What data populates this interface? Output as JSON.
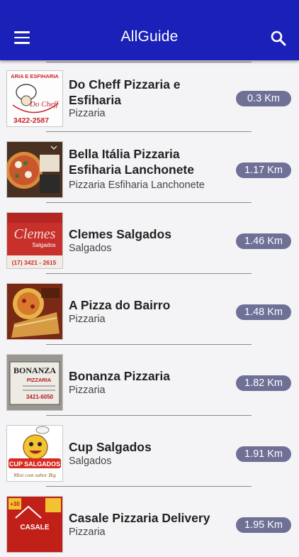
{
  "app": {
    "title": "AllGuide",
    "menu_icon": "hamburger-menu-icon",
    "search_icon": "search-icon",
    "colors": {
      "appbar": "#1a20b8",
      "badge": "#6f7096",
      "background": "#f4f4f6"
    }
  },
  "places": [
    {
      "name": "Do Cheff Pizzaria e Esfiharia",
      "category": "Pizzaria",
      "distance": "0.3 Km",
      "thumb_text": [
        "ARIA E ESFIHARIA",
        "Do Cheff",
        "3422-2587"
      ]
    },
    {
      "name": "Bella Itália Pizzaria Esfiharia Lanchonete",
      "category": "Pizzaria Esfiharia Lanchonete",
      "distance": "1.17 Km",
      "thumb_text": []
    },
    {
      "name": "Clemes Salgados",
      "category": "Salgados",
      "distance": "1.46 Km",
      "thumb_text": [
        "Clemes",
        "Salgados",
        "(17) 3421 - 2615"
      ]
    },
    {
      "name": "A Pizza do Bairro",
      "category": "Pizzaria",
      "distance": "1.48 Km",
      "thumb_text": []
    },
    {
      "name": "Bonanza Pizzaria",
      "category": "Pizzaria",
      "distance": "1.82 Km",
      "thumb_text": [
        "BONANZA",
        "PIZZARIA",
        "3421-6050"
      ]
    },
    {
      "name": "Cup Salgados",
      "category": "Salgados",
      "distance": "1.91 Km",
      "thumb_text": [
        "CUP SALGADOS",
        "Mini com sabor Big"
      ]
    },
    {
      "name": "Casale Pizzaria Delivery",
      "category": "Pizzaria",
      "distance": "1.95 Km",
      "thumb_text": [
        "+30",
        "CASALE"
      ]
    }
  ]
}
